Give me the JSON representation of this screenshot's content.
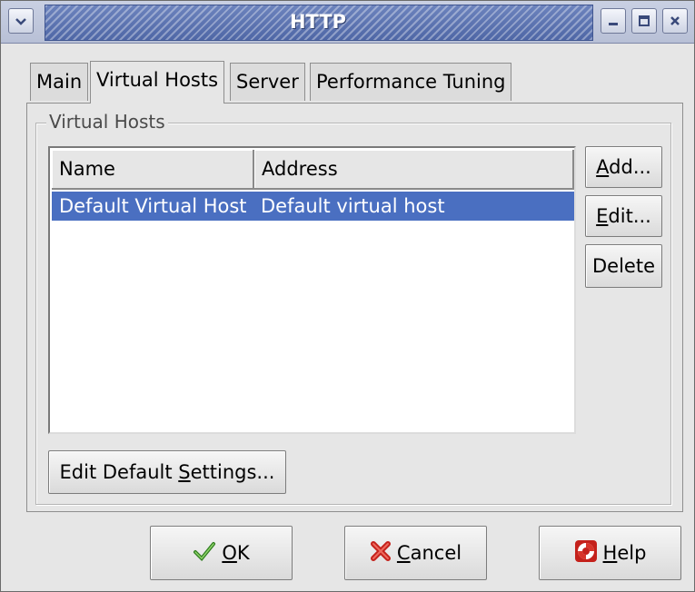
{
  "window": {
    "title": "HTTP"
  },
  "tabs": [
    {
      "label": "Main",
      "active": false
    },
    {
      "label": "Virtual Hosts",
      "active": true
    },
    {
      "label": "Server",
      "active": false
    },
    {
      "label": "Performance Tuning",
      "active": false
    }
  ],
  "virtual_hosts": {
    "group_label": "Virtual Hosts",
    "columns": [
      "Name",
      "Address"
    ],
    "rows": [
      {
        "name": "Default Virtual Host",
        "address": "Default virtual host",
        "selected": true
      }
    ],
    "buttons": {
      "add": {
        "mnemonic": "A",
        "rest": "dd..."
      },
      "edit": {
        "mnemonic": "E",
        "rest": "dit..."
      },
      "delete": "Delete"
    },
    "edit_default": {
      "before": "Edit Default ",
      "mnemonic": "S",
      "after": "ettings..."
    }
  },
  "dialog_buttons": {
    "ok": {
      "mnemonic": "O",
      "rest": "K",
      "icon": "checkmark-icon"
    },
    "cancel": {
      "mnemonic": "C",
      "rest": "ancel",
      "icon": "cancel-x-icon"
    },
    "help": {
      "mnemonic": "H",
      "rest": "elp",
      "icon": "lifebuoy-icon"
    }
  },
  "colors": {
    "selection": "#4a6fc1",
    "titlebar": "#5a71b0",
    "background": "#e6e6e6"
  }
}
